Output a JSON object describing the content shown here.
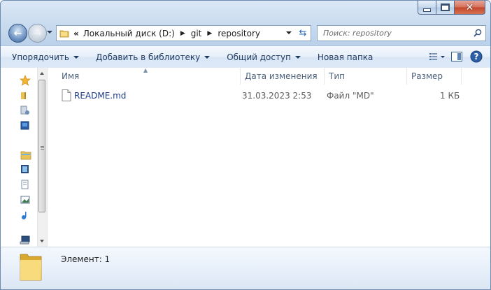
{
  "address": {
    "prefix": "«",
    "crumbs": [
      "Локальный диск (D:)",
      "git",
      "repository"
    ]
  },
  "search": {
    "placeholder": "Поиск: repository"
  },
  "toolbar": {
    "organize": "Упорядочить",
    "add_to_library": "Добавить в библиотеку",
    "share": "Общий доступ",
    "new_folder": "Новая папка"
  },
  "columns": {
    "name": "Имя",
    "date": "Дата изменения",
    "type": "Тип",
    "size": "Размер"
  },
  "files": [
    {
      "name": "README.md",
      "date": "31.03.2023 2:53",
      "type": "Файл \"MD\"",
      "size": "1 КБ"
    }
  ],
  "status": {
    "label": "Элемент: 1"
  },
  "colors": {
    "link_text": "#1e3a8a",
    "accent": "#3a6ea5"
  }
}
